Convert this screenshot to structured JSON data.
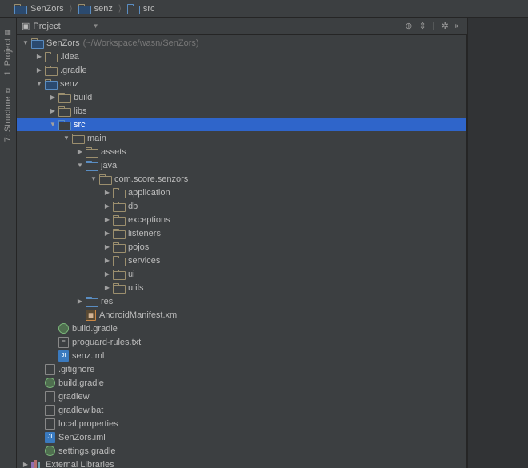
{
  "breadcrumb": [
    {
      "label": "SenZors",
      "icon": "module"
    },
    {
      "label": "senz",
      "icon": "module"
    },
    {
      "label": "src",
      "icon": "blue"
    }
  ],
  "side_tabs": [
    {
      "label": "1: Project",
      "icon": "▦"
    },
    {
      "label": "7: Structure",
      "icon": "⧉"
    }
  ],
  "panel": {
    "title": "Project",
    "actions": {
      "target": "⊕",
      "collapse": "⇕",
      "divider": "|",
      "gear": "✲",
      "hide": "⇤"
    }
  },
  "tree_flat": [
    {
      "d": 0,
      "a": "down",
      "i": "folder-module",
      "t": "SenZors",
      "muted": "(~/Workspace/wasn/SenZors)"
    },
    {
      "d": 1,
      "a": "right",
      "i": "folder",
      "t": ".idea"
    },
    {
      "d": 1,
      "a": "right",
      "i": "folder",
      "t": ".gradle"
    },
    {
      "d": 1,
      "a": "down",
      "i": "folder-module",
      "t": "senz"
    },
    {
      "d": 2,
      "a": "right",
      "i": "folder",
      "t": "build"
    },
    {
      "d": 2,
      "a": "right",
      "i": "folder",
      "t": "libs"
    },
    {
      "d": 2,
      "a": "down",
      "i": "folder-blue",
      "t": "src",
      "sel": true
    },
    {
      "d": 3,
      "a": "down",
      "i": "folder",
      "t": "main"
    },
    {
      "d": 4,
      "a": "right",
      "i": "folder",
      "t": "assets"
    },
    {
      "d": 4,
      "a": "down",
      "i": "folder-blue",
      "t": "java"
    },
    {
      "d": 5,
      "a": "down",
      "i": "folder",
      "t": "com.score.senzors"
    },
    {
      "d": 6,
      "a": "right",
      "i": "folder",
      "t": "application"
    },
    {
      "d": 6,
      "a": "right",
      "i": "folder",
      "t": "db"
    },
    {
      "d": 6,
      "a": "right",
      "i": "folder",
      "t": "exceptions"
    },
    {
      "d": 6,
      "a": "right",
      "i": "folder",
      "t": "listeners"
    },
    {
      "d": 6,
      "a": "right",
      "i": "folder",
      "t": "pojos"
    },
    {
      "d": 6,
      "a": "right",
      "i": "folder",
      "t": "services"
    },
    {
      "d": 6,
      "a": "right",
      "i": "folder",
      "t": "ui"
    },
    {
      "d": 6,
      "a": "right",
      "i": "folder",
      "t": "utils"
    },
    {
      "d": 4,
      "a": "right",
      "i": "folder-blue",
      "t": "res"
    },
    {
      "d": 4,
      "a": "none",
      "i": "xml-orange",
      "t": "AndroidManifest.xml"
    },
    {
      "d": 2,
      "a": "none",
      "i": "gradle",
      "t": "build.gradle"
    },
    {
      "d": 2,
      "a": "none",
      "i": "txt",
      "t": "proguard-rules.txt"
    },
    {
      "d": 2,
      "a": "none",
      "i": "iml",
      "t": "senz.iml"
    },
    {
      "d": 1,
      "a": "none",
      "i": "plain",
      "t": ".gitignore"
    },
    {
      "d": 1,
      "a": "none",
      "i": "gradle",
      "t": "build.gradle"
    },
    {
      "d": 1,
      "a": "none",
      "i": "plain",
      "t": "gradlew"
    },
    {
      "d": 1,
      "a": "none",
      "i": "plain",
      "t": "gradlew.bat"
    },
    {
      "d": 1,
      "a": "none",
      "i": "plain",
      "t": "local.properties"
    },
    {
      "d": 1,
      "a": "none",
      "i": "iml",
      "t": "SenZors.iml"
    },
    {
      "d": 1,
      "a": "none",
      "i": "gradle",
      "t": "settings.gradle"
    },
    {
      "d": 0,
      "a": "right",
      "i": "lib",
      "t": "External Libraries"
    }
  ]
}
